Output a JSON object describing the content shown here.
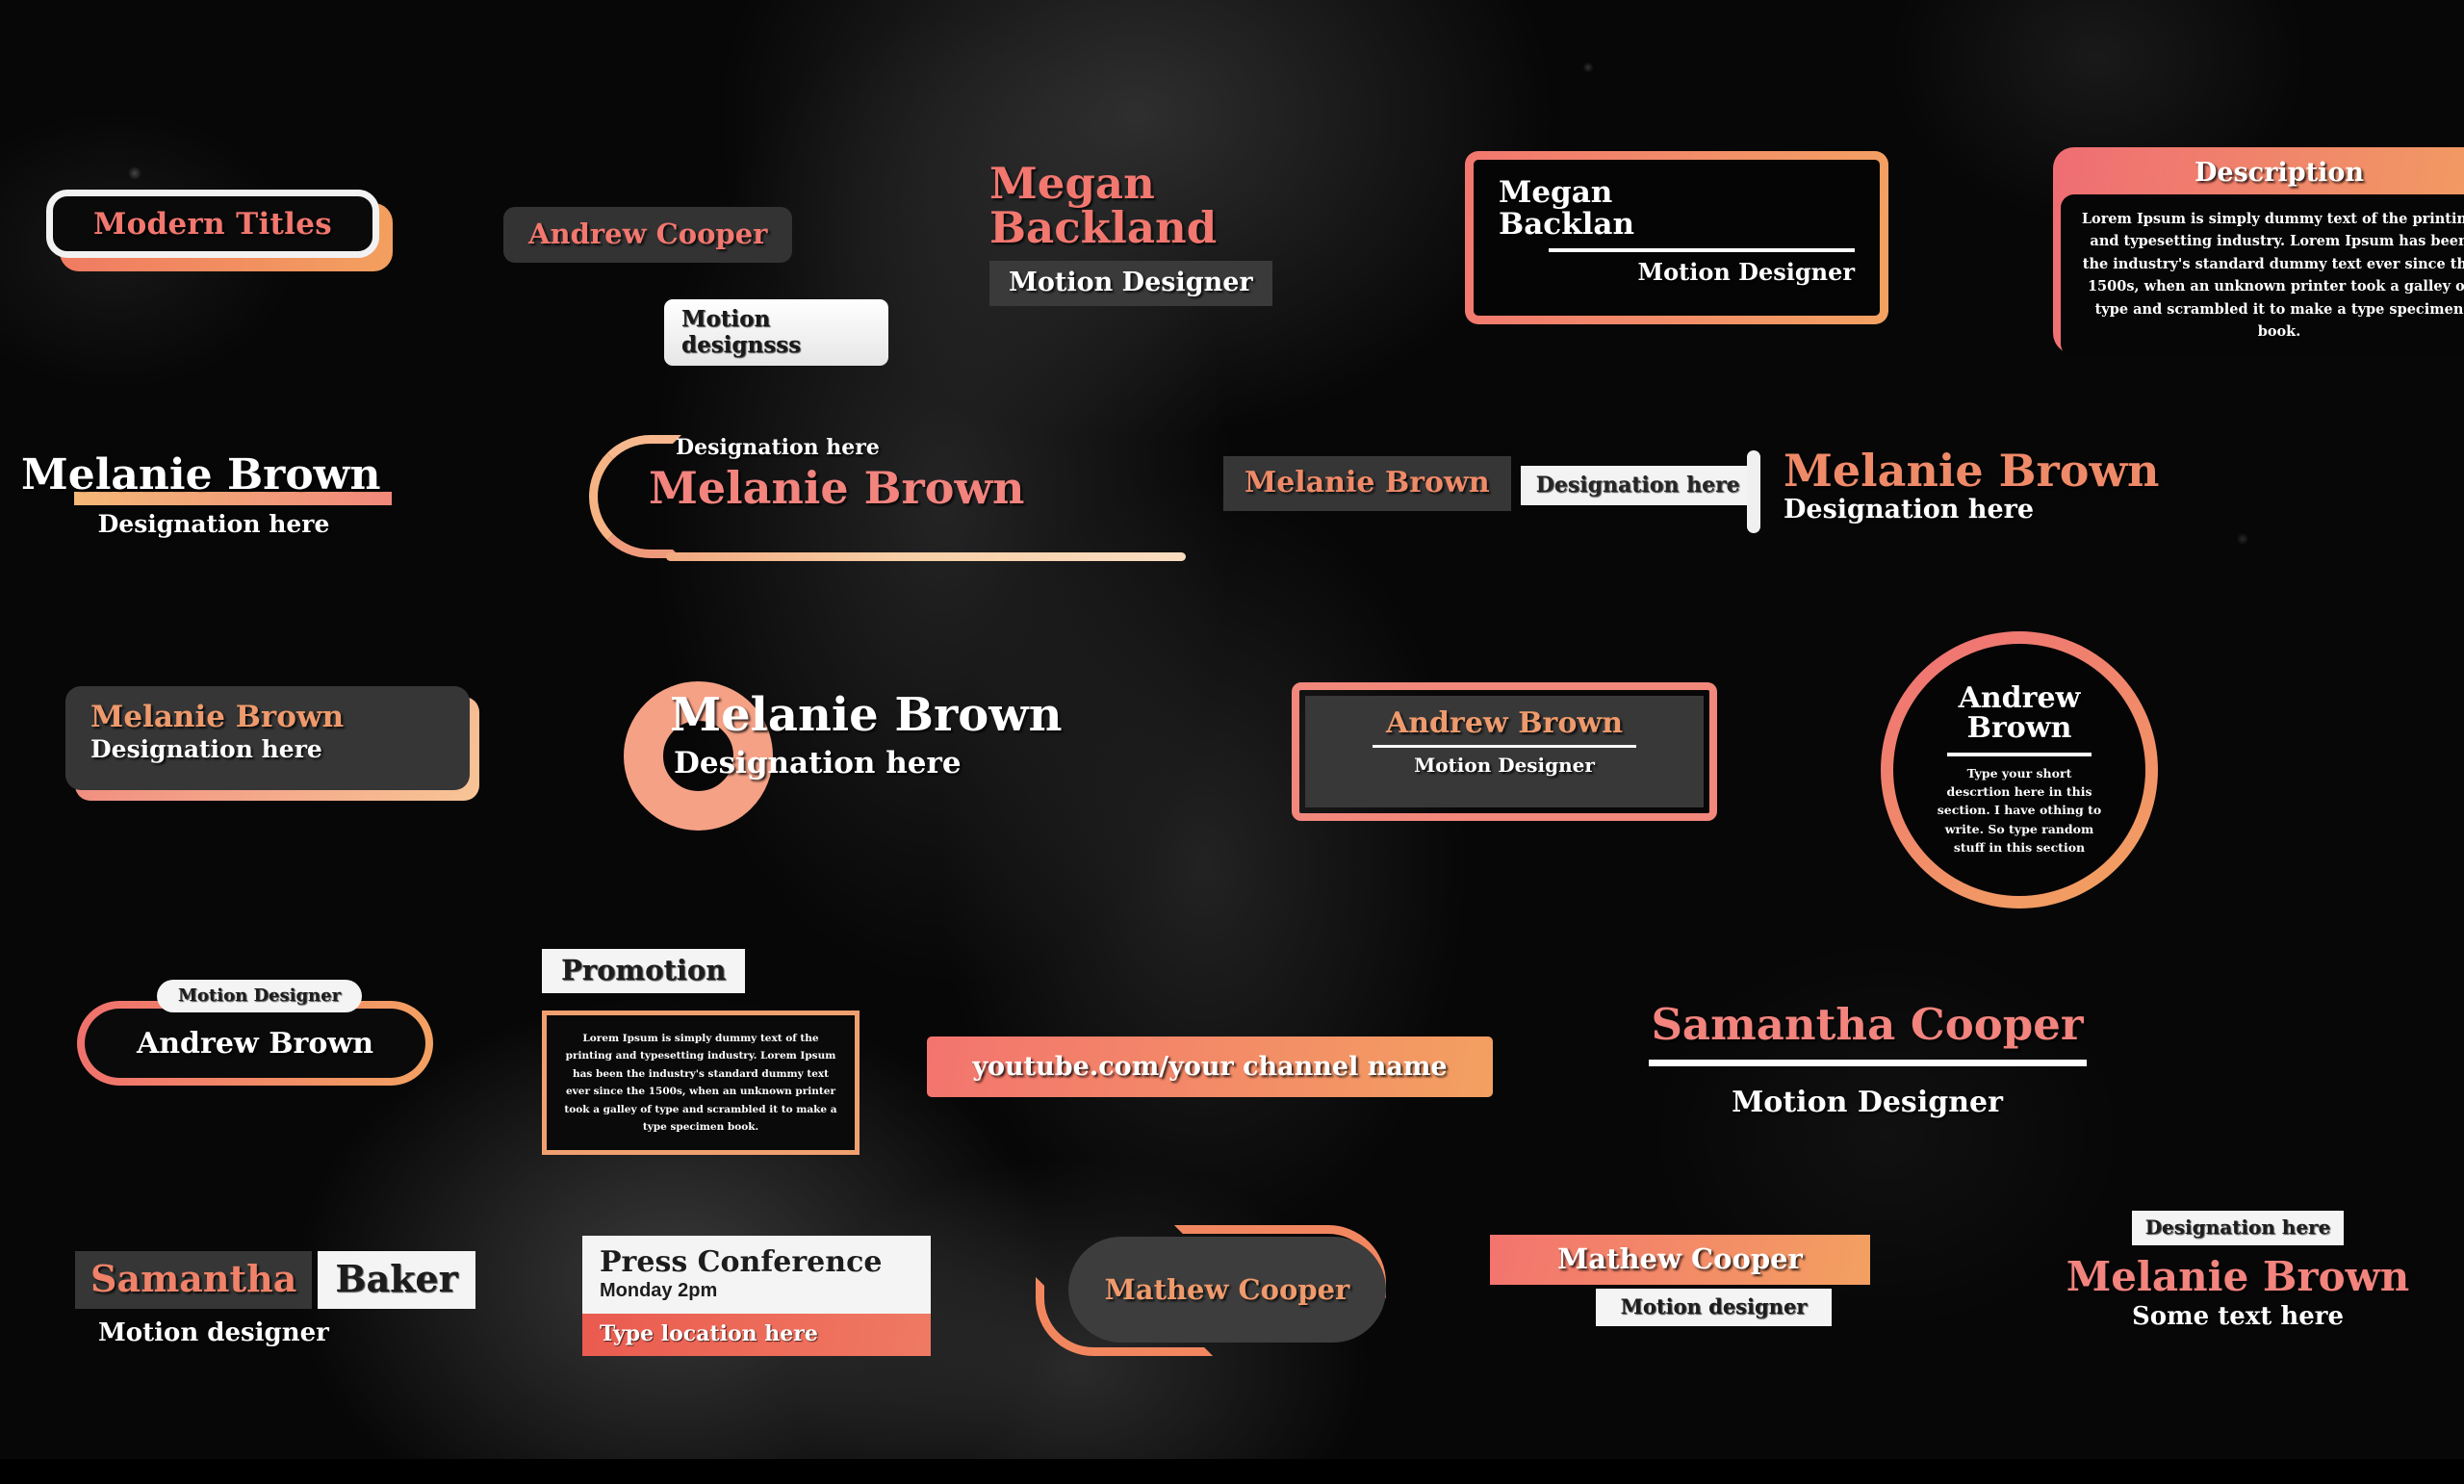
{
  "scene": {
    "background_description": "dark monochrome photo of a person, heavily darkened",
    "accent_coral": "#f2776f",
    "accent_orange": "#f3a061",
    "panel_gray": "#363636",
    "panel_white": "#f4f4f4"
  },
  "titles": {
    "modern_titles": {
      "label": "Modern Titles"
    },
    "andrew_cooper": {
      "name": "Andrew Cooper",
      "role": "Motion designsss"
    },
    "megan_backland": {
      "line1": "Megan",
      "line2": "Backland",
      "role": "Motion Designer"
    },
    "megan_framed": {
      "line1": "Megan",
      "line2": "Backlan",
      "role": "Motion Designer"
    },
    "description": {
      "heading": "Description",
      "body": "Lorem Ipsum is simply dummy text of the printing and typesetting industry. Lorem Ipsum has been the industry's standard dummy text ever since the 1500s, when an unknown printer took a galley of type and scrambled it to make a type specimen book."
    },
    "melanie_underline": {
      "name": "Melanie Brown",
      "role": "Designation here"
    },
    "melanie_arc": {
      "role": "Designation here",
      "name": "Melanie Brown"
    },
    "melanie_boxed": {
      "name": "Melanie Brown",
      "role": "Designation here"
    },
    "melanie_bar": {
      "name": "Melanie Brown",
      "role": "Designation here"
    },
    "melanie_card": {
      "name": "Melanie Brown",
      "role": "Designation here"
    },
    "melanie_ring": {
      "name": "Melanie Brown",
      "role": "Designation here"
    },
    "andrew_boxed": {
      "name": "Andrew Brown",
      "role": "Motion Designer"
    },
    "andrew_circle": {
      "line1": "Andrew",
      "line2": "Brown",
      "body": "Type your short descrtion here in this section. I have othing to write. So type random stuff in this section"
    },
    "andrew_pill": {
      "name": "Andrew Brown",
      "role": "Motion Designer"
    },
    "promotion": {
      "heading": "Promotion",
      "body": "Lorem Ipsum is simply dummy text of the printing and typesetting industry. Lorem Ipsum has been the industry's standard dummy text ever since the 1500s, when an unknown printer took a galley of type and scrambled it to make a type specimen book."
    },
    "youtube": {
      "url": "youtube.com/your channel name"
    },
    "samantha_cooper": {
      "name": "Samantha Cooper",
      "role": "Motion Designer"
    },
    "samantha_baker": {
      "first": "Samantha",
      "last": "Baker",
      "role": "Motion designer"
    },
    "press_conference": {
      "title": "Press Conference",
      "when": "Monday 2pm",
      "location": "Type location here"
    },
    "mathew_brackets": {
      "name": "Mathew Cooper"
    },
    "mathew_bar": {
      "name": "Mathew Cooper",
      "role": "Motion designer"
    },
    "melanie_bottom_right": {
      "designation": "Designation here",
      "name": "Melanie Brown",
      "sub": "Some text here"
    }
  }
}
